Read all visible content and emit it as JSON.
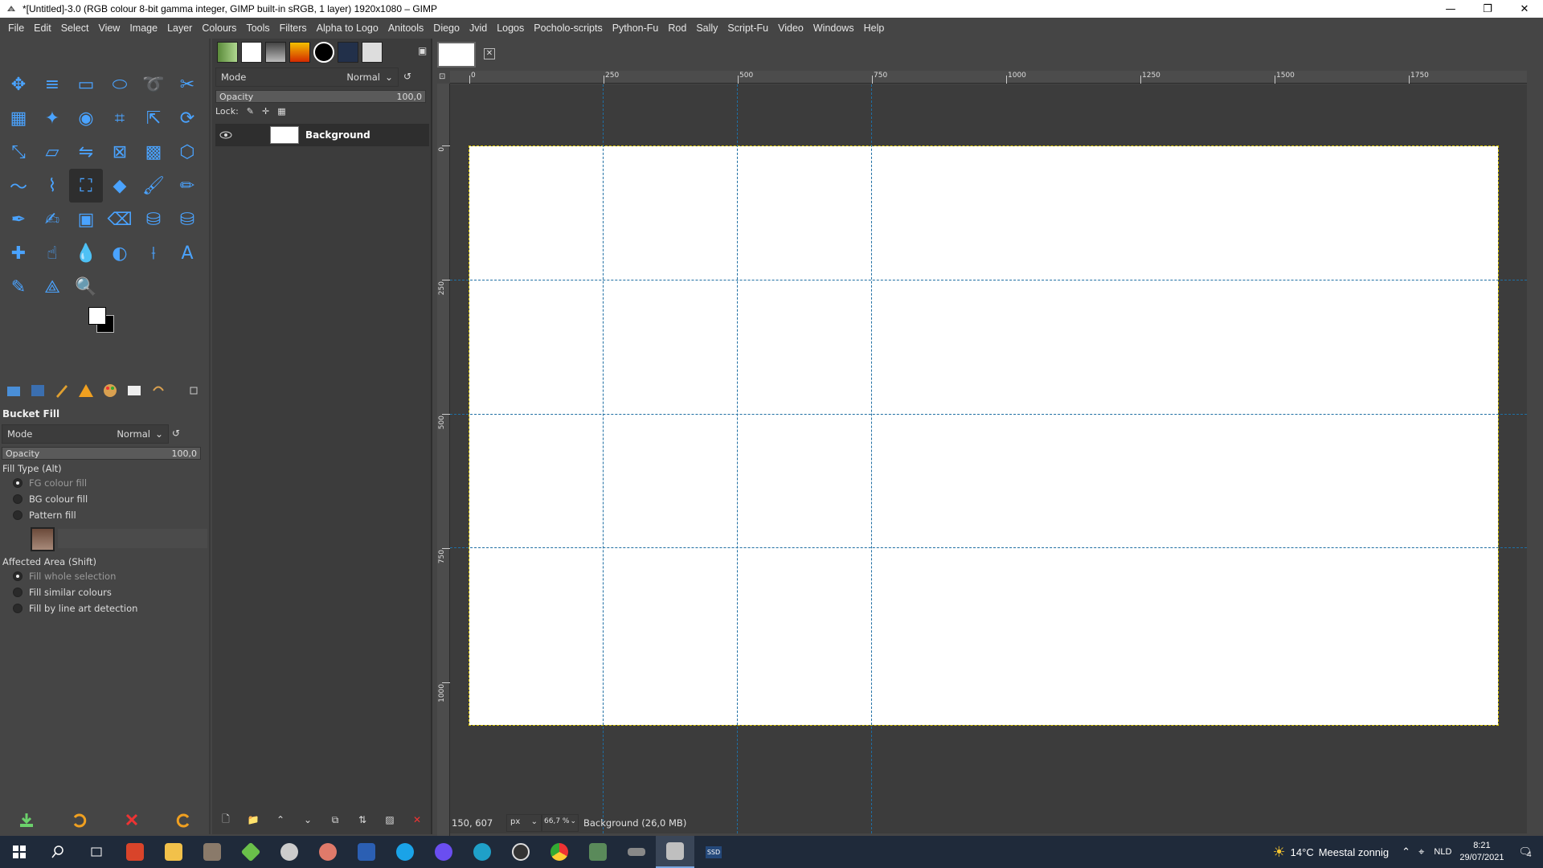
{
  "window": {
    "title": "*[Untitled]-3.0 (RGB colour 8-bit gamma integer, GIMP built-in sRGB, 1 layer) 1920x1080 – GIMP",
    "controls": [
      "—",
      "❐",
      "✕"
    ]
  },
  "menubar": [
    "File",
    "Edit",
    "Select",
    "View",
    "Image",
    "Layer",
    "Colours",
    "Tools",
    "Filters",
    "Alpha to Logo",
    "Anitools",
    "Diego",
    "Jvid",
    "Logos",
    "Pocholo-scripts",
    "Python-Fu",
    "Rod",
    "Sally",
    "Script-Fu",
    "Video",
    "Windows",
    "Help"
  ],
  "toolbox": {
    "tools": [
      "move",
      "align",
      "rect-select",
      "ellipse-select",
      "free-select",
      "scissors",
      "foreground-select",
      "fuzzy-select",
      "by-colour-select",
      "crop",
      "unified-transform",
      "rotate",
      "scale",
      "shear",
      "flip",
      "perspective",
      "3d-transform",
      "cage",
      "warp",
      "paths",
      "bucket-fill",
      "gradient",
      "paintbrush",
      "pencil",
      "airbrush",
      "ink",
      "mypaint-brush",
      "eraser",
      "clone",
      "perspective-clone",
      "heal",
      "smudge",
      "blur",
      "dodge-burn",
      "measure",
      "text",
      "colour-picker",
      "handle-transform",
      "zoom"
    ],
    "active_tool": "bucket-fill",
    "colors": {
      "fg": "#ffffff",
      "bg": "#000000"
    }
  },
  "tool_options": {
    "title": "Bucket Fill",
    "mode_label": "Mode",
    "mode_value": "Normal",
    "opacity_label": "Opacity",
    "opacity_value": "100,0",
    "fill_type_label": "Fill Type  (Alt)",
    "fill_types": [
      "FG colour fill",
      "BG colour fill",
      "Pattern fill"
    ],
    "fill_type_selected": 0,
    "affected_area_label": "Affected Area  (Shift)",
    "affected_areas": [
      "Fill whole selection",
      "Fill similar colours",
      "Fill by line art detection"
    ],
    "affected_area_selected": 0
  },
  "layers_panel": {
    "mode_label": "Mode",
    "mode_value": "Normal",
    "opacity_label": "Opacity",
    "opacity_value": "100,0",
    "lock_label": "Lock:",
    "layers": [
      {
        "name": "Background",
        "visible": true
      }
    ]
  },
  "rulers": {
    "h_labels": [
      "0",
      "250",
      "500",
      "750",
      "1000",
      "1250",
      "1500",
      "1750"
    ],
    "v_labels": [
      "0",
      "250",
      "500",
      "750",
      "1000"
    ]
  },
  "status": {
    "coords": "150, 607",
    "unit": "px",
    "zoom": "66,7 %",
    "info": "Background (26,0 MB)"
  },
  "taskbar": {
    "weather_temp": "14°C",
    "weather_text": "Meestal zonnig",
    "lang": "NLD",
    "time": "8:21",
    "date": "29/07/2021",
    "notif_count": "4",
    "ssd_label": "SSD"
  }
}
